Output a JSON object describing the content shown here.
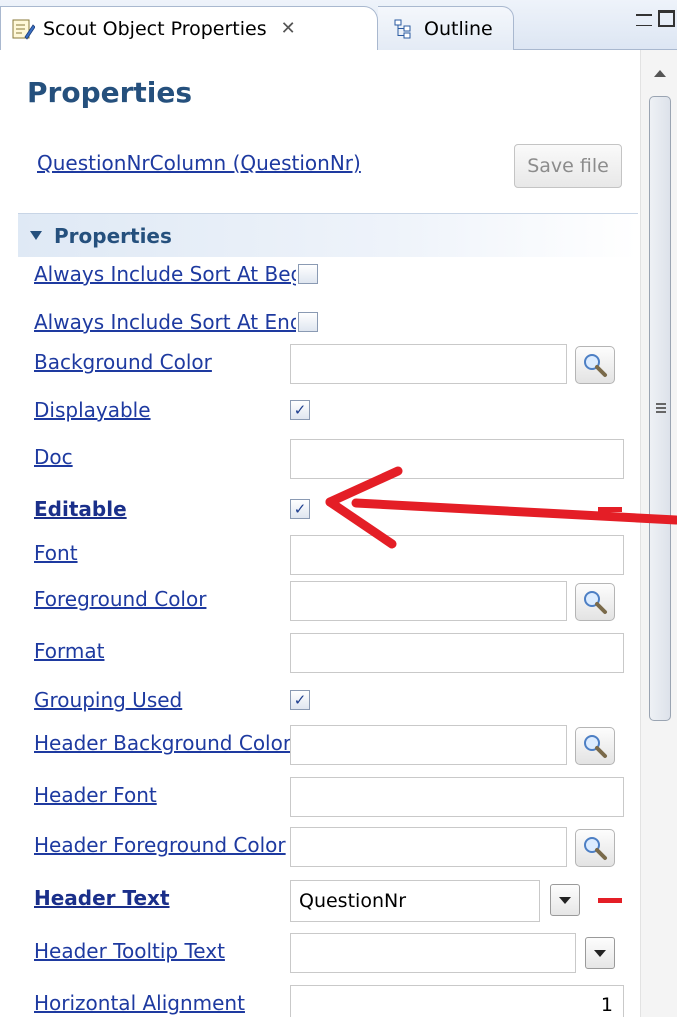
{
  "tabs": {
    "active_label": "Scout Object Properties",
    "close_glyph": "✕",
    "inactive_label": "Outline"
  },
  "panel": {
    "title": "Properties",
    "object_link": "QuestionNrColumn (QuestionNr)",
    "save_label": "Save file",
    "section_title": "Properties"
  },
  "properties": [
    {
      "label": "Always Include Sort At Begin",
      "type": "checkbox",
      "checked": false
    },
    {
      "label": "Always Include Sort At End",
      "type": "checkbox",
      "checked": false
    },
    {
      "label": "Background Color",
      "type": "color",
      "value": ""
    },
    {
      "label": "Displayable",
      "type": "checkbox",
      "checked": true
    },
    {
      "label": "Doc",
      "type": "text",
      "value": ""
    },
    {
      "label": "Editable",
      "type": "checkbox",
      "checked": true,
      "bold": true,
      "modified": true
    },
    {
      "label": "Font",
      "type": "text",
      "value": ""
    },
    {
      "label": "Foreground Color",
      "type": "color",
      "value": ""
    },
    {
      "label": "Format",
      "type": "text",
      "value": ""
    },
    {
      "label": "Grouping Used",
      "type": "checkbox",
      "checked": true
    },
    {
      "label": "Header Background Color",
      "type": "color",
      "value": ""
    },
    {
      "label": "Header Font",
      "type": "text",
      "value": ""
    },
    {
      "label": "Header Foreground Color",
      "type": "color",
      "value": ""
    },
    {
      "label": "Header Text",
      "type": "combo",
      "value": "QuestionNr",
      "bold": true,
      "modified": true
    },
    {
      "label": "Header Tooltip Text",
      "type": "combo",
      "value": ""
    },
    {
      "label": "Horizontal Alignment",
      "type": "number",
      "value": "1"
    }
  ],
  "check_glyph": "✓",
  "colors": {
    "title": "#25507d",
    "link": "#1e3aa0",
    "annotation": "#e41e26"
  },
  "icons": {
    "tab_active": "edit-properties-icon",
    "tab_inactive": "outline-icon",
    "lookup": "magnifier-icon",
    "modified": "minus-icon"
  }
}
